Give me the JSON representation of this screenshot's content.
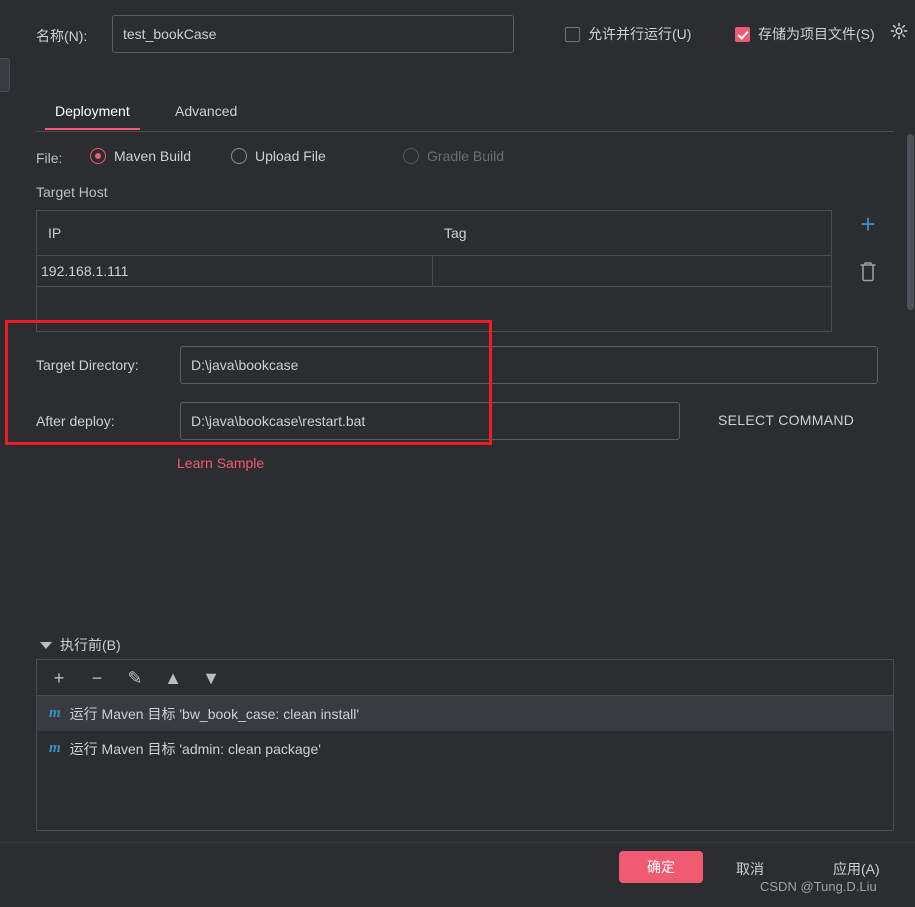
{
  "header": {
    "name_label": "名称(N):",
    "name_value": "test_bookCase",
    "parallel_label": "允许并行运行(U)",
    "store_label": "存储为项目文件(S)",
    "gear_icon": "gear-icon"
  },
  "tabs": [
    {
      "label": "Deployment",
      "active": true
    },
    {
      "label": "Advanced",
      "active": false
    }
  ],
  "file_row": {
    "label": "File:",
    "options": [
      {
        "label": "Maven Build",
        "selected": true,
        "disabled": false
      },
      {
        "label": "Upload File",
        "selected": false,
        "disabled": false
      },
      {
        "label": "Gradle Build",
        "selected": false,
        "disabled": true
      }
    ]
  },
  "target_host": {
    "title": "Target Host",
    "columns": [
      "IP",
      "Tag"
    ],
    "rows": [
      {
        "ip": "192.168.1.111",
        "tag": ""
      }
    ],
    "add_icon": "plus-icon",
    "delete_icon": "trash-icon"
  },
  "fields": {
    "target_directory_label": "Target Directory:",
    "target_directory_value": "D:\\java\\bookcase",
    "after_deploy_label": "After deploy:",
    "after_deploy_value": "D:\\java\\bookcase\\restart.bat",
    "select_command_label": "SELECT COMMAND",
    "learn_sample_label": "Learn Sample"
  },
  "before_launch": {
    "title": "执行前(B)",
    "toolbar": [
      {
        "name": "add",
        "glyph": "+"
      },
      {
        "name": "remove",
        "glyph": "−"
      },
      {
        "name": "edit",
        "glyph": "✎"
      },
      {
        "name": "move-up",
        "glyph": "▲"
      },
      {
        "name": "move-down",
        "glyph": "▼"
      }
    ],
    "items": [
      {
        "icon": "maven-icon",
        "text": "运行 Maven 目标 'bw_book_case: clean install'",
        "selected": true
      },
      {
        "icon": "maven-icon",
        "text": "运行 Maven 目标 'admin: clean package'",
        "selected": false
      }
    ]
  },
  "footer": {
    "ok_label": "确定",
    "cancel_label": "取消",
    "apply_label": "应用(A)",
    "watermark": "CSDN @Tung.D.Liu"
  },
  "colors": {
    "accent": "#f05b72",
    "link": "#3592c4",
    "annotation": "#ee1c25",
    "background": "#2b2d30"
  }
}
